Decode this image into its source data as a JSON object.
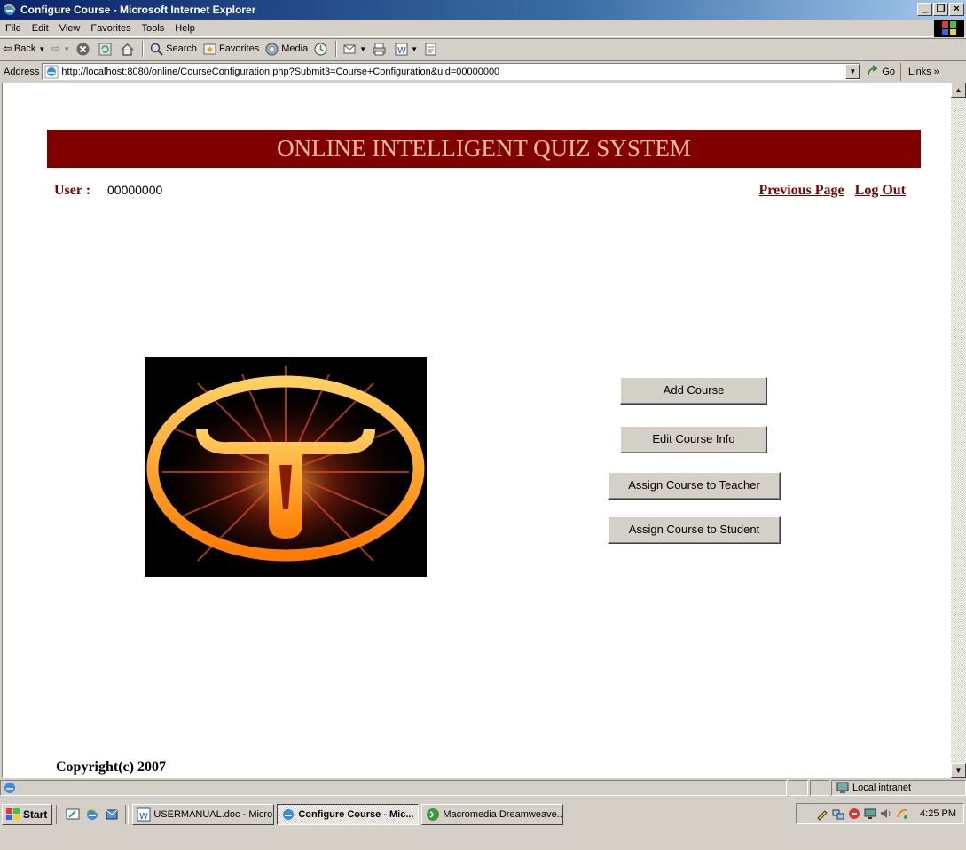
{
  "window": {
    "title": "Configure Course - Microsoft Internet Explorer",
    "buttons": [
      "_",
      "̵",
      "×"
    ]
  },
  "menubar": {
    "items": [
      "File",
      "Edit",
      "View",
      "Favorites",
      "Tools",
      "Help"
    ]
  },
  "toolbar": {
    "back_label": "Back",
    "search_label": "Search",
    "favorites_label": "Favorites",
    "media_label": "Media"
  },
  "addressbar": {
    "label": "Address",
    "url": "http://localhost:8080/online/CourseConfiguration.php?Submit3=Course+Configuration&uid=00000000",
    "go_label": "Go",
    "links_label": "Links »"
  },
  "page": {
    "banner": "ONLINE INTELLIGENT QUIZ SYSTEM",
    "user_label": "User :",
    "user_value": "00000000",
    "previous_page": "Previous Page",
    "log_out": "Log Out",
    "buttons": {
      "add_course": "Add Course",
      "edit_course": "Edit Course Info",
      "assign_teacher": "Assign Course to Teacher",
      "assign_student": "Assign Course to Student"
    },
    "copyright": "Copyright(c) 2007"
  },
  "statusbar": {
    "zone": "Local intranet"
  },
  "taskbar": {
    "start_label": "Start",
    "tasks": [
      {
        "label": "USERMANUAL.doc - Micro...",
        "icon": "word-icon",
        "active": false
      },
      {
        "label": "Configure Course - Mic...",
        "icon": "ie-icon",
        "active": true
      },
      {
        "label": "Macromedia Dreamweave...",
        "icon": "dreamweaver-icon",
        "active": false
      }
    ],
    "clock": "4:25 PM"
  }
}
